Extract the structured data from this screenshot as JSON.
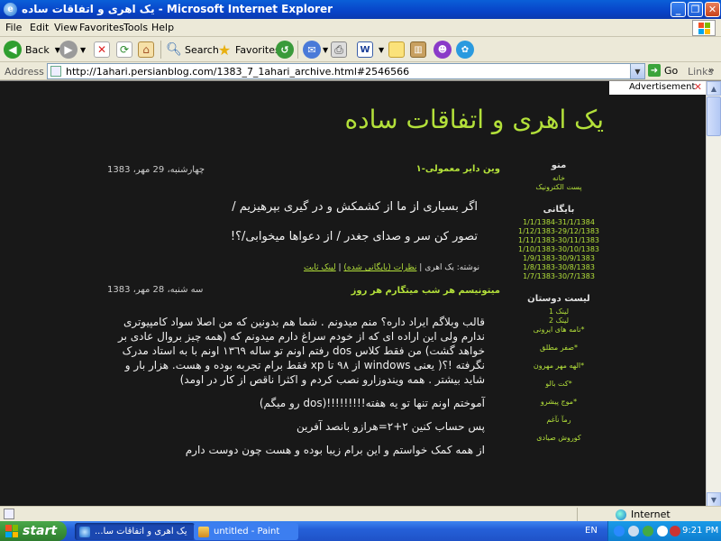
{
  "window": {
    "title": "یک اهری و اتفاقات ساده - Microsoft Internet Explorer",
    "app_icon": "ie-icon"
  },
  "menu": [
    "File",
    "Edit",
    "View",
    "Favorites",
    "Tools",
    "Help"
  ],
  "toolbar": {
    "back": "Back",
    "search": "Search",
    "favorites": "Favorites"
  },
  "address": {
    "label": "Address",
    "url": "http://1ahari.persianblog.com/1383_7_1ahari_archive.html#2546566",
    "go": "Go",
    "links": "Links",
    "more": "»"
  },
  "adbar": {
    "label": "Advertisement",
    "close": "✕"
  },
  "blog": {
    "title": "یک اهری و اتفاقات ساده",
    "posts": [
      {
        "title": "وین دایر معمولی-۱",
        "date": "چهارشنبه، 29 مهر، 1383",
        "lines": [
          "اگر بسیاری از ما از کشمکش و در گیری بپرهیزیم /",
          "تصور کن سر و صدای جغدر / از دعواها میخوابی/؟!"
        ],
        "footer_by": "نوشته: یک اهری | ",
        "footer_comments": "نظرات (بایگانی شده)",
        "footer_sep": " | ",
        "footer_permalink": "لینک ثابت"
      },
      {
        "title": "میتونیسم هر شب میتگارم هر روز",
        "date": "سه شنبه، 28 مهر، 1383",
        "paragraphs": [
          "قالب وبلاگم ایراد داره؟ منم میدونم . شما هم بدونین که من اصلا سواد کامپیوتری ندارم ولی این اراده ای که از خودم سراغ دارم میدونم که (همه چیز بروال عادی بر خواهد گشت) من فقط کلاس dos رفتم اونم تو ساله ١٣٦٩ اونم با به استاد مدرک نگرفته !؟( یعنی windows از ٩٨ تا xp فقط برام تجربه بوده و هست. هزار بار و شاید بیشتر . همه ویندوزارو نصب کردم و اکثرا ناقص از کار در اومد)",
          "آموختم اونم تنها تو یه هفته!!!!!!!!!(dos رو میگم)",
          "پس حساب کنین ٢+٢=هرازو بانصد آفرین",
          "از همه کمک خواستم و این برام زیبا بوده و هست چون دوست دارم"
        ]
      }
    ]
  },
  "sidebar": {
    "menu_title": "منو",
    "menu_items": [
      "خانه",
      "پست الکترونیک"
    ],
    "archive_title": "بایگانی",
    "archive_items": [
      "1/1/1384-31/1/1384",
      "1/12/1383-29/12/1383",
      "1/11/1383-30/11/1383",
      "1/10/1383-30/10/1383",
      "1/9/1383-30/9/1383",
      "1/8/1383-30/8/1383",
      "1/7/1383-30/7/1383"
    ],
    "friends_title": "لیست دوستان",
    "friends_items": [
      "لینک 1",
      "لینک 2",
      "نامه های ایرونی*",
      "صفر مطلق*",
      "الهه مهر مهرون*",
      "کت بالو*",
      "موج پیشرو*",
      "رمآ نآغم",
      "کوروش صیادی"
    ]
  },
  "status": {
    "zone": "Internet"
  },
  "taskbar": {
    "start": "start",
    "tasks": [
      "یک اهری و اتفاقات سا...",
      "untitled - Paint"
    ],
    "lang": "EN",
    "clock": "9:21 PM"
  }
}
